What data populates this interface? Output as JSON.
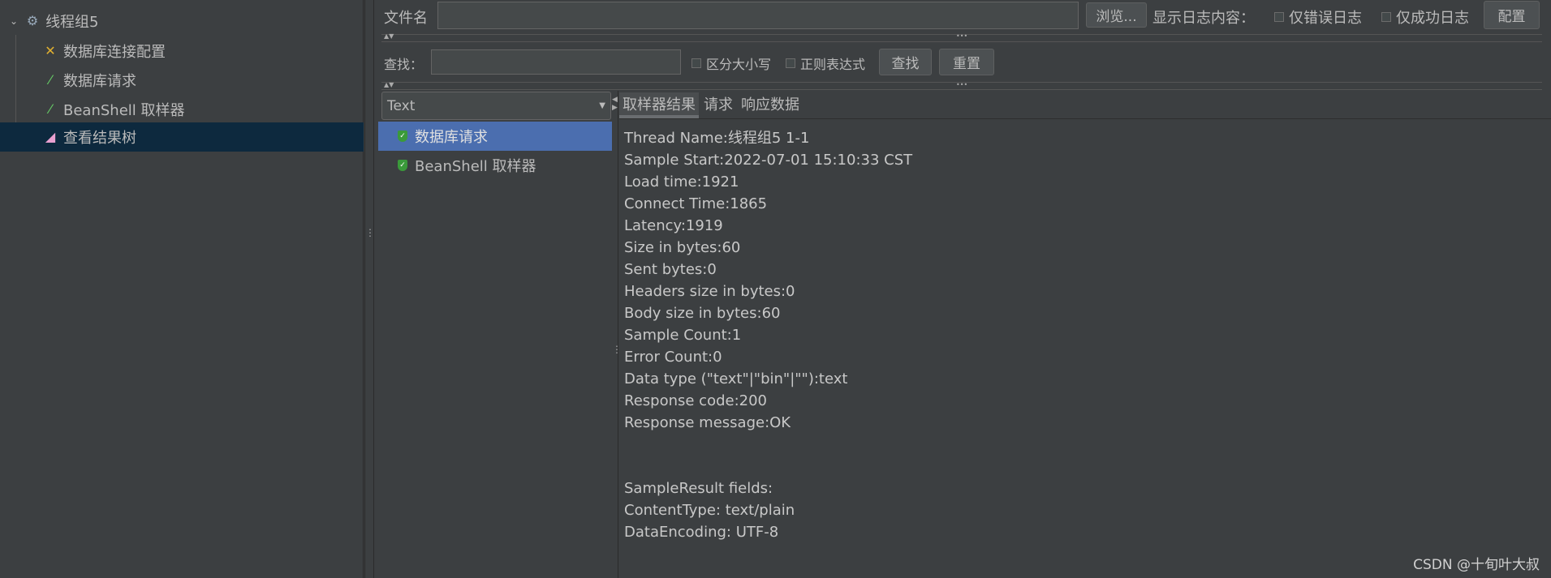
{
  "tree": {
    "root": "线程组5",
    "children": [
      {
        "label": "数据库连接配置",
        "icon": "wrench-screwdriver-icon"
      },
      {
        "label": "数据库请求",
        "icon": "pipette-icon"
      },
      {
        "label": "BeanShell 取样器",
        "icon": "pipette-icon"
      },
      {
        "label": "查看结果树",
        "icon": "chart-icon",
        "selected": true
      }
    ]
  },
  "toolbar": {
    "filename_label": "文件名",
    "filename_value": "",
    "browse": "浏览...",
    "log_label": "显示日志内容：",
    "errors_only": "仅错误日志",
    "success_only": "仅成功日志",
    "configure": "配置"
  },
  "search": {
    "label": "查找：",
    "value": "",
    "case_sensitive": "区分大小写",
    "regex": "正则表达式",
    "find": "查找",
    "reset": "重置"
  },
  "renderer": {
    "selected": "Text"
  },
  "results": [
    {
      "label": "数据库请求",
      "status": "success",
      "selected": true
    },
    {
      "label": "BeanShell 取样器",
      "status": "success"
    }
  ],
  "tabs": [
    {
      "label": "取样器结果",
      "active": true
    },
    {
      "label": "请求"
    },
    {
      "label": "响应数据"
    }
  ],
  "sampler_result": [
    "Thread Name:线程组5 1-1",
    "Sample Start:2022-07-01 15:10:33 CST",
    "Load time:1921",
    "Connect Time:1865",
    "Latency:1919",
    "Size in bytes:60",
    "Sent bytes:0",
    "Headers size in bytes:0",
    "Body size in bytes:60",
    "Sample Count:1",
    "Error Count:0",
    "Data type (\"text\"|\"bin\"|\"\"):text",
    "Response code:200",
    "Response message:OK",
    "",
    "",
    "SampleResult fields:",
    "ContentType: text/plain",
    "DataEncoding: UTF-8"
  ],
  "watermark": "CSDN @十旬叶大叔",
  "colors": {
    "background": "#3c3f41",
    "selection": "#4b6eaf",
    "tree_selection": "#0d293e"
  }
}
